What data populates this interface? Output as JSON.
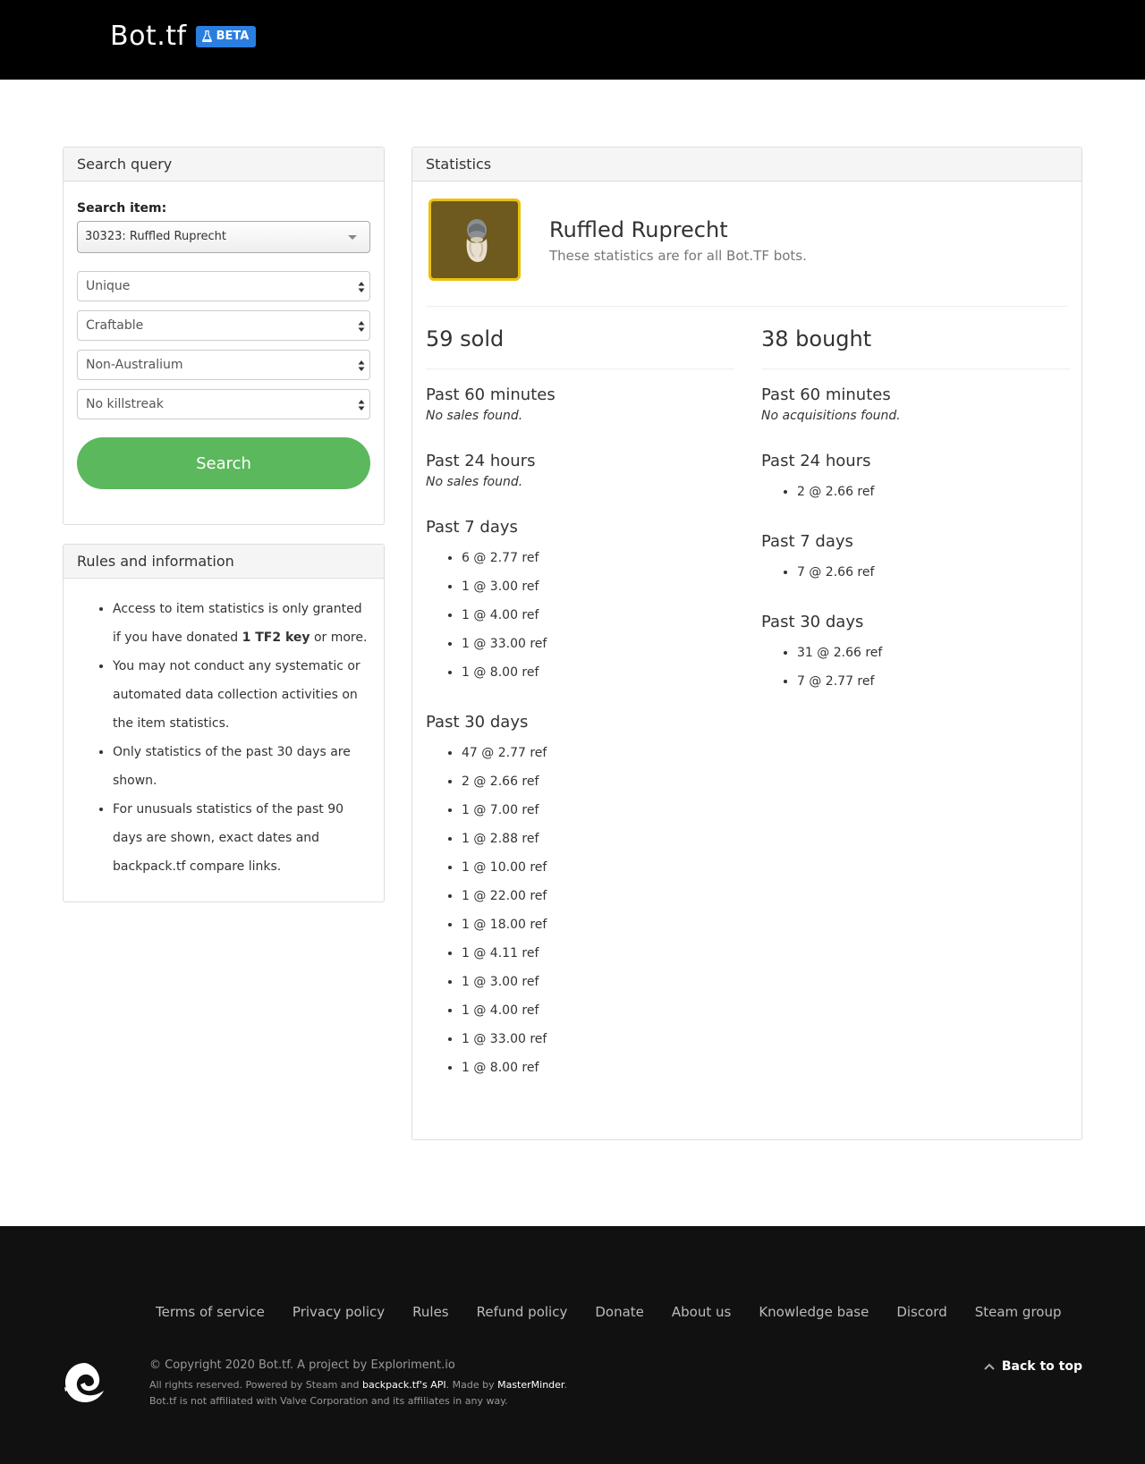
{
  "header": {
    "brand": "Bot.tf",
    "badge": "BETA"
  },
  "search_panel": {
    "title": "Search query",
    "item_label": "Search item:",
    "item_value": "30323: Ruffled Ruprecht",
    "quality": "Unique",
    "craftable": "Craftable",
    "australium": "Non-Australium",
    "killstreak": "No killstreak",
    "search_button": "Search"
  },
  "rules_panel": {
    "title": "Rules and information",
    "rule1_pre": "Access to item statistics is only granted if you have donated ",
    "rule1_bold": "1 TF2 key",
    "rule1_post": " or more.",
    "rule2": "You may not conduct any systematic or automated data collection activities on the item statistics.",
    "rule3": "Only statistics of the past 30 days are shown.",
    "rule4": "For unusuals statistics of the past 90 days are shown, exact dates and backpack.tf compare links."
  },
  "stats_panel": {
    "title": "Statistics",
    "item_name": "Ruffled Ruprecht",
    "subtitle": "These statistics are for all Bot.TF bots.",
    "sold": {
      "title": "59 sold",
      "p60_label": "Past 60 minutes",
      "p60_empty": "No sales found.",
      "p24_label": "Past 24 hours",
      "p24_empty": "No sales found.",
      "p7_label": "Past 7 days",
      "p7": [
        "6 @ 2.77 ref",
        "1 @ 3.00 ref",
        "1 @ 4.00 ref",
        "1 @ 33.00 ref",
        "1 @ 8.00 ref"
      ],
      "p30_label": "Past 30 days",
      "p30": [
        "47 @ 2.77 ref",
        "2 @ 2.66 ref",
        "1 @ 7.00 ref",
        "1 @ 2.88 ref",
        "1 @ 10.00 ref",
        "1 @ 22.00 ref",
        "1 @ 18.00 ref",
        "1 @ 4.11 ref",
        "1 @ 3.00 ref",
        "1 @ 4.00 ref",
        "1 @ 33.00 ref",
        "1 @ 8.00 ref"
      ]
    },
    "bought": {
      "title": "38 bought",
      "p60_label": "Past 60 minutes",
      "p60_empty": "No acquisitions found.",
      "p24_label": "Past 24 hours",
      "p24": [
        "2 @ 2.66 ref"
      ],
      "p7_label": "Past 7 days",
      "p7": [
        "7 @ 2.66 ref"
      ],
      "p30_label": "Past 30 days",
      "p30": [
        "31 @ 2.66 ref",
        "7 @ 2.77 ref"
      ]
    }
  },
  "footer": {
    "nav": [
      "Terms of service",
      "Privacy policy",
      "Rules",
      "Refund policy",
      "Donate",
      "About us",
      "Knowledge base",
      "Discord",
      "Steam group"
    ],
    "copyright": "© Copyright 2020 Bot.tf. A project by Exploriment.io",
    "line2_pre": "All rights reserved. Powered by Steam and ",
    "line2_link1": "backpack.tf's API",
    "line2_mid": ". Made by ",
    "line2_link2": "MasterMinder",
    "line2_post": ".",
    "line3": "Bot.tf is not affiliated with Valve Corporation and its affiliates in any way.",
    "back_to_top": "Back to top"
  },
  "colors": {
    "header_bg": "#000000",
    "badge": "#2a7ee0",
    "search_button": "#5cb85c",
    "item_border": "#e8c10e",
    "item_bg": "#6e5a1e",
    "footer_bg": "#111111"
  }
}
